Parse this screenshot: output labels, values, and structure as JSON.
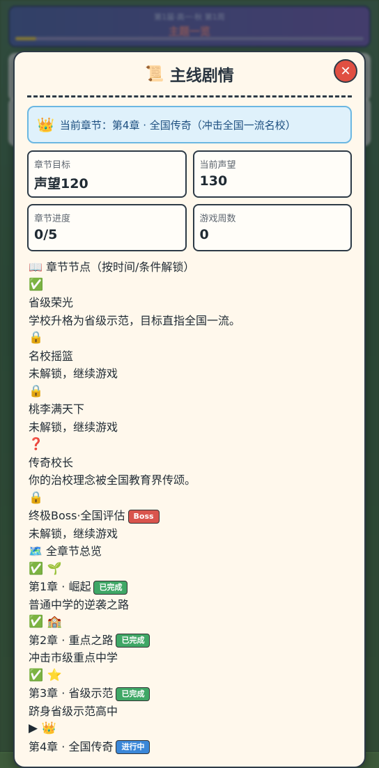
{
  "background": {
    "top_line1": "第1届·高一·秋 第1周",
    "top_line2": "主题一览"
  },
  "modal": {
    "title_icon": "📜",
    "title": "主线剧情",
    "close_label": "✕",
    "current_chapter": {
      "icon": "👑",
      "text": "当前章节：第4章 · 全国传奇（冲击全国一流名校）"
    },
    "stats": [
      {
        "label": "章节目标",
        "value": "声望120"
      },
      {
        "label": "当前声望",
        "value": "130"
      },
      {
        "label": "章节进度",
        "value": "0/5"
      },
      {
        "label": "游戏周数",
        "value": "0"
      }
    ],
    "nodes_header": "📖 章节节点（按时间/条件解锁）",
    "nodes": [
      {
        "status_icon": "✅",
        "name": "省级荣光",
        "desc": "学校升格为省级示范，目标直指全国一流。",
        "badge": ""
      },
      {
        "status_icon": "🔒",
        "name": "名校摇篮",
        "desc": "未解锁，继续游戏",
        "badge": ""
      },
      {
        "status_icon": "🔒",
        "name": "桃李满天下",
        "desc": "未解锁，继续游戏",
        "badge": ""
      },
      {
        "status_icon": "❓",
        "name": "传奇校长",
        "desc": "你的治校理念被全国教育界传颂。",
        "badge": ""
      },
      {
        "status_icon": "🔒",
        "name": "终极Boss·全国评估",
        "desc": "未解锁，继续游戏",
        "badge": "Boss"
      }
    ],
    "overview_header": "🗺️ 全章节总览",
    "chapters": [
      {
        "icons": "✅ 🌱",
        "name": "第1章 · 崛起",
        "badge": "已完成",
        "desc": "普通中学的逆袭之路"
      },
      {
        "icons": "✅ 🏫",
        "name": "第2章 · 重点之路",
        "badge": "已完成",
        "desc": "冲击市级重点中学"
      },
      {
        "icons": "✅ ⭐",
        "name": "第3章 · 省级示范",
        "badge": "已完成",
        "desc": "跻身省级示范高中"
      },
      {
        "icons": "▶ 👑",
        "name": "第4章 · 全国传奇",
        "badge": "进行中",
        "desc": ""
      }
    ]
  }
}
